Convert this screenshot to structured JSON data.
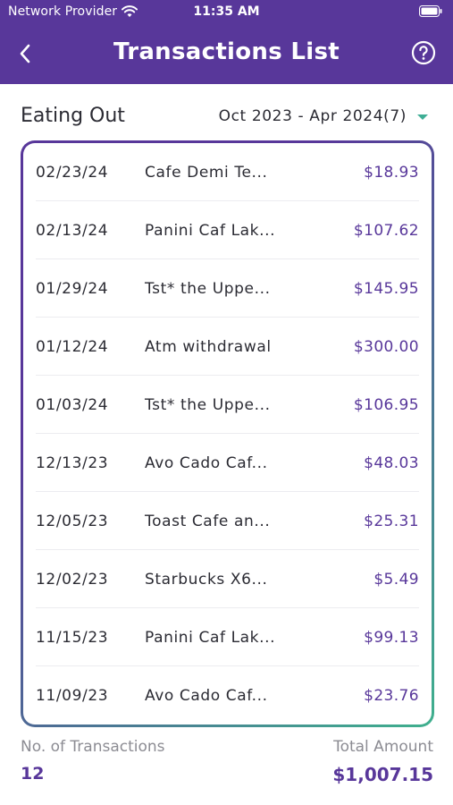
{
  "status_bar": {
    "carrier": "Network Provider",
    "time": "11:35 AM"
  },
  "nav": {
    "title": "Transactions List",
    "back_icon": "chevron-left-icon",
    "help_icon": "question-circle-icon"
  },
  "filter": {
    "category": "Eating Out",
    "date_range": "Oct 2023 - Apr 2024(7)"
  },
  "transactions": [
    {
      "date": "02/23/24",
      "merchant": "Cafe Demi Te...",
      "amount": "$18.93"
    },
    {
      "date": "02/13/24",
      "merchant": "Panini Caf Lak...",
      "amount": "$107.62"
    },
    {
      "date": "01/29/24",
      "merchant": "Tst* the Uppe...",
      "amount": "$145.95"
    },
    {
      "date": "01/12/24",
      "merchant": "Atm withdrawal",
      "amount": "$300.00"
    },
    {
      "date": "01/03/24",
      "merchant": "Tst* the Uppe...",
      "amount": "$106.95"
    },
    {
      "date": "12/13/23",
      "merchant": "Avo Cado Caf...",
      "amount": "$48.03"
    },
    {
      "date": "12/05/23",
      "merchant": "Toast Cafe an...",
      "amount": "$25.31"
    },
    {
      "date": "12/02/23",
      "merchant": "Starbucks X6...",
      "amount": "$5.49"
    },
    {
      "date": "11/15/23",
      "merchant": "Panini Caf Lak...",
      "amount": "$99.13"
    },
    {
      "date": "11/09/23",
      "merchant": "Avo Cado Caf...",
      "amount": "$23.76"
    }
  ],
  "summary": {
    "count_label": "No. of Transactions",
    "count_value": "12",
    "total_label": "Total Amount",
    "total_value": "$1,007.15"
  },
  "colors": {
    "brand_purple": "#58379a",
    "accent_green": "#3fb08e"
  }
}
